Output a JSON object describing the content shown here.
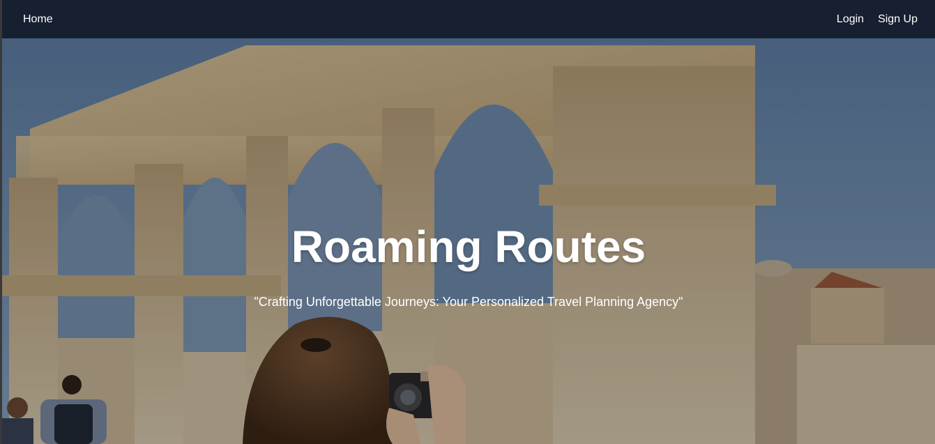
{
  "nav": {
    "home_label": "Home",
    "login_label": "Login",
    "signup_label": "Sign Up"
  },
  "hero": {
    "title": "Roaming Routes",
    "tagline": "\"Crafting Unforgettable Journeys: Your Personalized Travel Planning Agency\""
  },
  "colors": {
    "navbar_bg": "#172030",
    "text": "#ffffff",
    "sky": "#6f8db0",
    "stone": "#c9b28a"
  }
}
